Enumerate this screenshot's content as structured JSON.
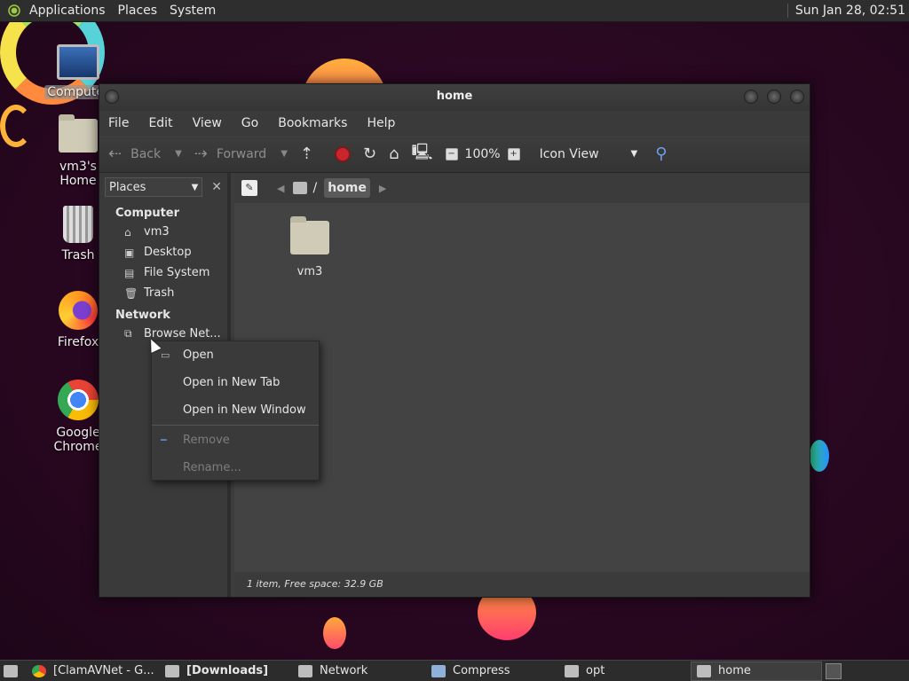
{
  "top_panel": {
    "menus": [
      "Applications",
      "Places",
      "System"
    ],
    "clock": "Sun Jan 28, 02:51"
  },
  "desktop": {
    "icons": [
      {
        "label": "Computer",
        "icon": "computer-icon"
      },
      {
        "label": "vm3's Home",
        "icon": "home-folder-icon"
      },
      {
        "label": "Trash",
        "icon": "trash-icon"
      },
      {
        "label": "Firefox",
        "icon": "firefox-icon"
      },
      {
        "label": "Google Chrome",
        "icon": "chrome-icon"
      }
    ]
  },
  "window": {
    "title": "home",
    "menus": [
      "File",
      "Edit",
      "View",
      "Go",
      "Bookmarks",
      "Help"
    ],
    "toolbar": {
      "back": "Back",
      "forward": "Forward",
      "zoom": "100%",
      "view_mode": "Icon View"
    },
    "sidebar": {
      "selector": "Places",
      "sections": [
        {
          "title": "Computer",
          "items": [
            "vm3",
            "Desktop",
            "File System",
            "Trash"
          ]
        },
        {
          "title": "Network",
          "items": [
            "Browse Net..."
          ]
        }
      ]
    },
    "pathbar": {
      "separator": "/",
      "current": "home"
    },
    "files": [
      {
        "name": "vm3",
        "icon": "home-folder-icon"
      }
    ],
    "status": "1 item, Free space: 32.9 GB"
  },
  "context_menu": {
    "items": [
      {
        "label": "Open",
        "enabled": true
      },
      {
        "label": "Open in New Tab",
        "enabled": true
      },
      {
        "label": "Open in New Window",
        "enabled": true
      },
      {
        "label": "Remove",
        "enabled": false
      },
      {
        "label": "Rename...",
        "enabled": false
      }
    ]
  },
  "taskbar": {
    "tasks": [
      {
        "label": "[ClamAVNet - G...",
        "icon": "chrome-icon",
        "active": false
      },
      {
        "label": "[Downloads]",
        "icon": "folder-icon",
        "active": false
      },
      {
        "label": "Network",
        "icon": "network-icon",
        "active": false
      },
      {
        "label": "Compress",
        "icon": "archive-icon",
        "active": false
      },
      {
        "label": "opt",
        "icon": "folder-icon",
        "active": false
      },
      {
        "label": "home",
        "icon": "folder-icon",
        "active": true
      }
    ]
  }
}
